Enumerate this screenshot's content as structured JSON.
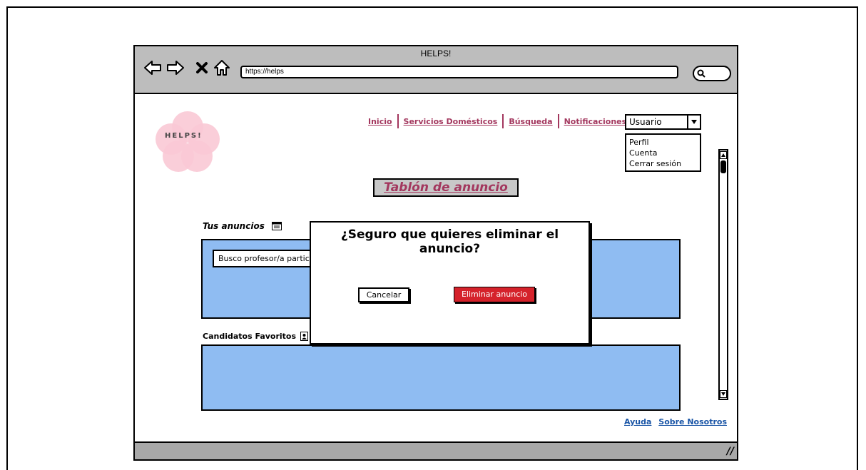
{
  "window": {
    "title": "HELPS!"
  },
  "browser": {
    "url": "https://helps"
  },
  "logo": {
    "text": "HELPS!"
  },
  "nav": {
    "items": [
      {
        "label": "Inicio"
      },
      {
        "label": "Servicios Domésticos"
      },
      {
        "label": "Búsqueda"
      },
      {
        "label": "Notificaciones"
      }
    ]
  },
  "user_menu": {
    "selected": "Usuario",
    "options": [
      "Perfil",
      "Cuenta",
      "Cerrar sesión"
    ]
  },
  "board": {
    "title": "Tablón de anuncio"
  },
  "ads_section": {
    "label": "Tus anuncios",
    "items": [
      {
        "text": "Busco profesor/a particular"
      }
    ]
  },
  "favorites_section": {
    "label": "Candidatos Favoritos"
  },
  "modal": {
    "title": "¿Seguro que quieres eliminar el anuncio?",
    "cancel_label": "Cancelar",
    "confirm_label": "Eliminar anuncio"
  },
  "footer": {
    "help": "Ayuda",
    "about": "Sobre Nosotros"
  },
  "colors": {
    "accent_link": "#a3375e",
    "panel_blue": "#8fbcf2",
    "danger": "#d5222b",
    "footer_link": "#1a55a6"
  }
}
